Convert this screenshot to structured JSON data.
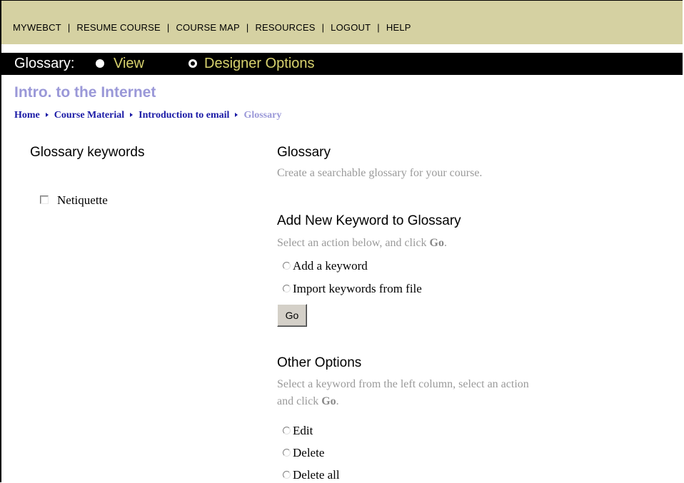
{
  "topnav": {
    "items": [
      "MYWEBCT",
      "RESUME COURSE",
      "COURSE MAP",
      "RESOURCES",
      "LOGOUT",
      "HELP"
    ],
    "separator": "|"
  },
  "modebar": {
    "label": "Glossary:",
    "options": [
      {
        "label": "View",
        "selected": false
      },
      {
        "label": "Designer Options",
        "selected": true
      }
    ]
  },
  "course": {
    "title": "Intro. to the Internet"
  },
  "breadcrumb": {
    "items": [
      "Home",
      "Course Material",
      "Introduction to email",
      "Glossary"
    ]
  },
  "left": {
    "heading": "Glossary keywords",
    "keywords": [
      {
        "label": "Netiquette",
        "checked": false
      }
    ]
  },
  "glossary": {
    "heading": "Glossary",
    "description": "Create a searchable glossary for your course."
  },
  "add_keyword": {
    "heading": "Add New Keyword to Glossary",
    "instruction_prefix": "Select an action below, and click ",
    "instruction_bold": "Go",
    "instruction_suffix": ".",
    "options": [
      "Add a keyword",
      "Import keywords from file"
    ],
    "go_label": "Go"
  },
  "other_options": {
    "heading": "Other Options",
    "instruction_line1": "Select a keyword from the left column, select an action",
    "instruction_line2_prefix": "and click ",
    "instruction_bold": "Go",
    "instruction_suffix": ".",
    "options": [
      "Edit",
      "Delete",
      "Delete all"
    ]
  },
  "colors": {
    "nav_bg": "#d5d1a2",
    "modebar_bg": "#000000",
    "mode_text": "#d8d26e",
    "course_title": "#9a98d8",
    "link_blue": "#1a1aa6",
    "muted_text": "#9a9a9a"
  }
}
